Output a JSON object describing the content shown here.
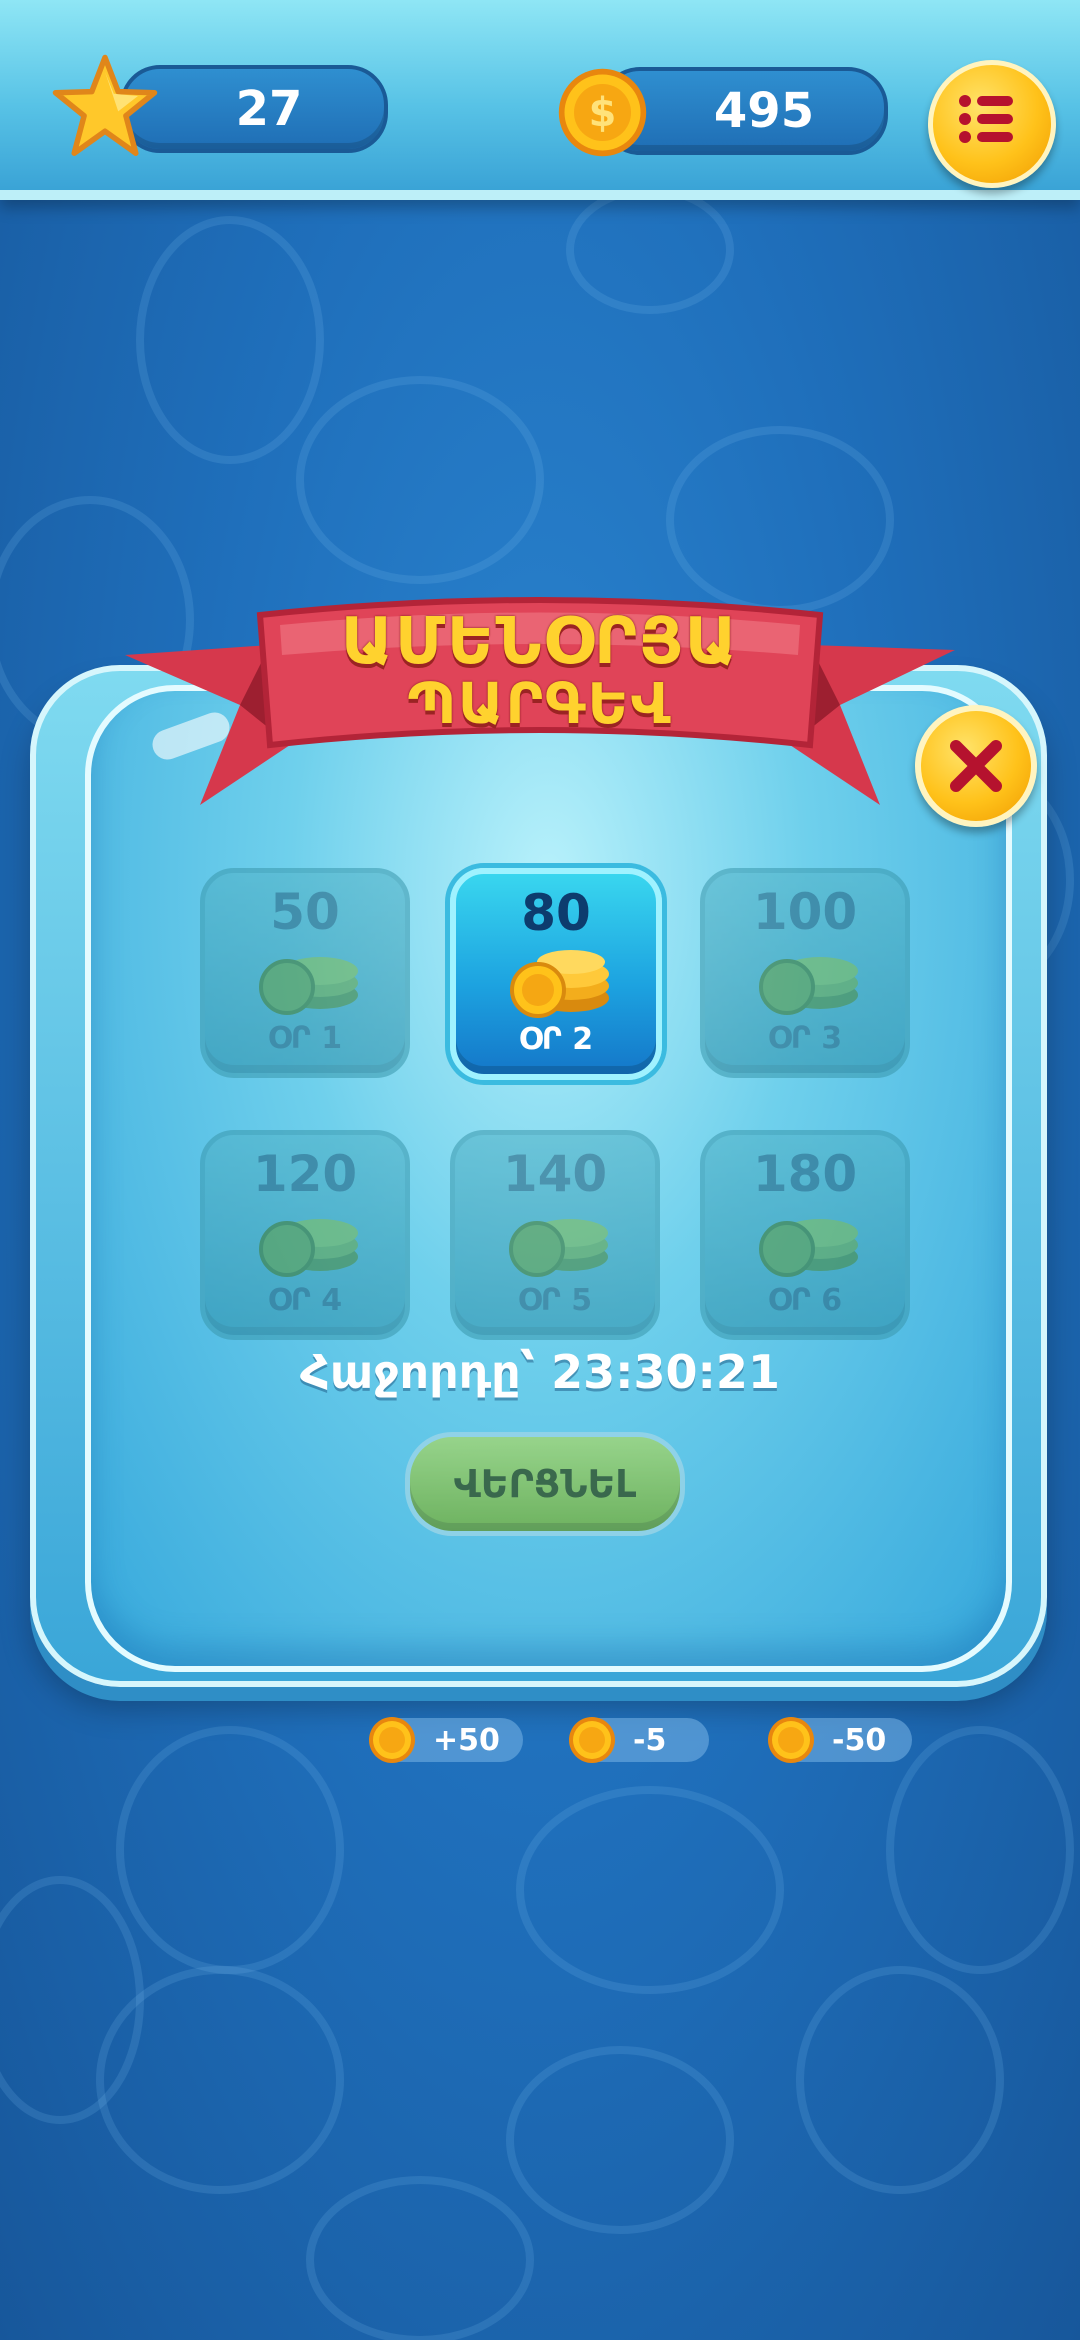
{
  "header": {
    "stars": "27",
    "coins": "495"
  },
  "dialog": {
    "title_line1": "ԱՄԵՆՕՐՅԱ",
    "title_line2": "ՊԱՐԳԵՎ",
    "days": [
      {
        "amount": "50",
        "label": "ՕՐ 1",
        "state": "locked"
      },
      {
        "amount": "80",
        "label": "ՕՐ 2",
        "state": "current"
      },
      {
        "amount": "100",
        "label": "ՕՐ 3",
        "state": "locked"
      },
      {
        "amount": "120",
        "label": "ՕՐ 4",
        "state": "locked"
      },
      {
        "amount": "140",
        "label": "ՕՐ 5",
        "state": "locked"
      },
      {
        "amount": "180",
        "label": "ՕՐ 6",
        "state": "locked"
      }
    ],
    "timer": "Հաջորդը՝ 23:30:21",
    "claim_label": "ՎԵՐՑՆԵԼ"
  },
  "coin_pills": [
    "+50",
    "-5",
    "-50"
  ],
  "colors": {
    "background": "#1f6fbb",
    "coin_gold": "#ffc21a",
    "ribbon_red": "#d9364a",
    "title_yellow": "#ffd22e"
  },
  "icons": [
    "star-icon",
    "coin-icon",
    "menu-icon",
    "close-icon",
    "coin-stack-icon"
  ]
}
